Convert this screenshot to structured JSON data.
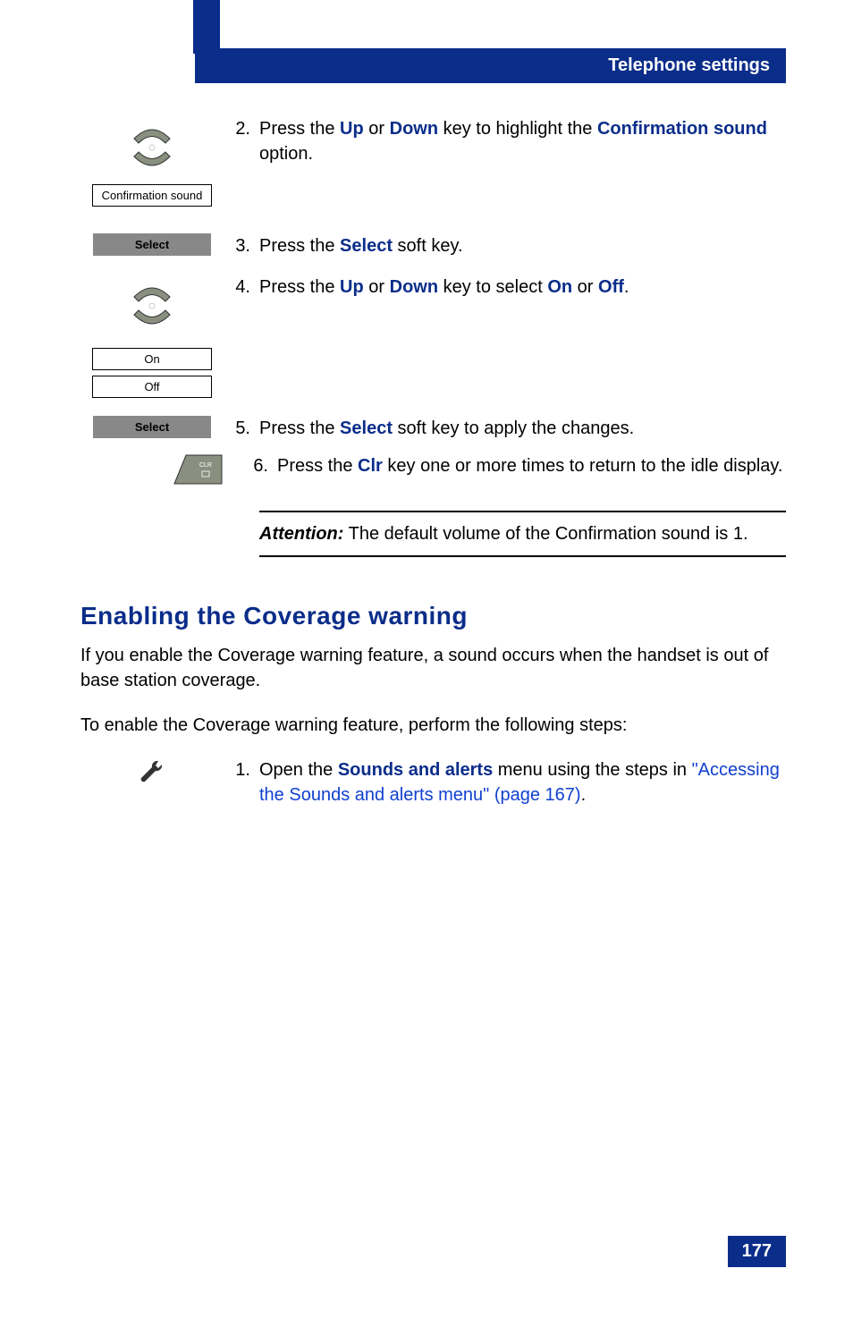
{
  "header": {
    "title": "Telephone settings"
  },
  "steps": [
    {
      "num": "2.",
      "parts": [
        {
          "t": "Press the "
        },
        {
          "t": "Up",
          "cls": "bold-blue"
        },
        {
          "t": " or "
        },
        {
          "t": "Down",
          "cls": "bold-blue"
        },
        {
          "t": " key to highlight the "
        },
        {
          "t": "Confirmation sound",
          "cls": "bold-blue"
        },
        {
          "t": " option."
        }
      ],
      "icon_label": "Confirmation sound",
      "icon_type": "nav"
    },
    {
      "num": "3.",
      "parts": [
        {
          "t": "Press the "
        },
        {
          "t": "Select",
          "cls": "bold-blue"
        },
        {
          "t": " soft key."
        }
      ],
      "icon_label": "Select",
      "icon_type": "softkey"
    },
    {
      "num": "4.",
      "parts": [
        {
          "t": "Press the "
        },
        {
          "t": "Up",
          "cls": "bold-blue"
        },
        {
          "t": " or "
        },
        {
          "t": "Down",
          "cls": "bold-blue"
        },
        {
          "t": " key to select "
        },
        {
          "t": "On",
          "cls": "bold-blue"
        },
        {
          "t": " or "
        },
        {
          "t": "Off",
          "cls": "bold-blue"
        },
        {
          "t": "."
        }
      ],
      "icon_label_1": "On",
      "icon_label_2": "Off",
      "icon_type": "nav2"
    },
    {
      "num": "5.",
      "parts": [
        {
          "t": "Press the "
        },
        {
          "t": "Select",
          "cls": "bold-blue"
        },
        {
          "t": " soft key to apply the changes."
        }
      ],
      "icon_label": "Select",
      "icon_type": "softkey"
    },
    {
      "num": "6.",
      "parts": [
        {
          "t": "Press the "
        },
        {
          "t": "Clr",
          "cls": "bold-blue"
        },
        {
          "t": " key one or more times to return to the idle display."
        }
      ],
      "icon_type": "clr"
    }
  ],
  "attention": {
    "label": "Attention:",
    "text": " The default volume of the Confirmation sound is 1."
  },
  "section": {
    "heading": "Enabling the Coverage warning",
    "para1": "If you enable the Coverage warning feature, a sound occurs when the handset is out of base station coverage.",
    "para2": "To enable the Coverage warning feature, perform the following steps:"
  },
  "step_lower": {
    "num": "1.",
    "parts": [
      {
        "t": "Open the "
      },
      {
        "t": "Sounds and alerts",
        "cls": "bold-blue"
      },
      {
        "t": " menu using the steps in "
      },
      {
        "t": "\"Accessing the Sounds and alerts menu\" (page 167)",
        "cls": "link-blue"
      },
      {
        "t": "."
      }
    ]
  },
  "page_number": "177"
}
